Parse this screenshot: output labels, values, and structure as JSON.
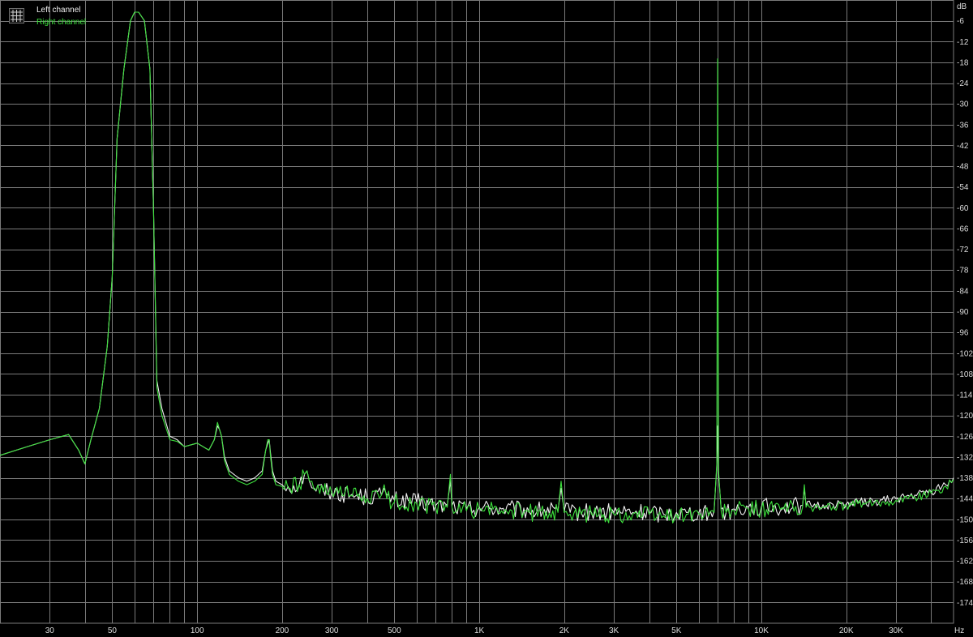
{
  "chart_data": {
    "type": "line",
    "title": "",
    "xlabel": "",
    "ylabel": "",
    "x_scale": "log",
    "x_unit": "Hz",
    "y_unit": "dB",
    "xlim": [
      20,
      48000
    ],
    "ylim": [
      -180,
      0
    ],
    "grid": true,
    "legend_position": "top-left",
    "legend_icon": "grid-icon",
    "x_ticks": [
      {
        "value": 30,
        "label": "30"
      },
      {
        "value": 50,
        "label": "50"
      },
      {
        "value": 100,
        "label": "100"
      },
      {
        "value": 200,
        "label": "200"
      },
      {
        "value": 300,
        "label": "300"
      },
      {
        "value": 500,
        "label": "500"
      },
      {
        "value": 1000,
        "label": "1K"
      },
      {
        "value": 2000,
        "label": "2K"
      },
      {
        "value": 3000,
        "label": "3K"
      },
      {
        "value": 5000,
        "label": "5K"
      },
      {
        "value": 10000,
        "label": "10K"
      },
      {
        "value": 20000,
        "label": "20K"
      },
      {
        "value": 30000,
        "label": "30K"
      }
    ],
    "x_minor_ticks": [
      40,
      60,
      70,
      80,
      90,
      400,
      600,
      700,
      800,
      900,
      4000,
      6000,
      7000,
      8000,
      9000,
      40000
    ],
    "y_ticks": [
      -6,
      -12,
      -18,
      -24,
      -30,
      -36,
      -42,
      -48,
      -54,
      -60,
      -66,
      -72,
      -78,
      -84,
      -90,
      -96,
      -102,
      -108,
      -114,
      -120,
      -126,
      -132,
      -138,
      -144,
      -150,
      -156,
      -162,
      -168,
      -174
    ],
    "colors": {
      "background": "#000000",
      "grid": "#7a7a7a",
      "ticks": "#dcdcdc",
      "legend_box": "#6e6e6e"
    },
    "series": [
      {
        "name": "Left channel",
        "color": "#f0f0f0",
        "x": [
          20,
          25,
          30,
          35,
          38,
          40,
          42,
          45,
          48,
          50,
          52,
          55,
          58,
          60,
          62,
          65,
          68,
          70,
          72,
          75,
          80,
          85,
          90,
          100,
          110,
          115,
          118,
          120,
          122,
          125,
          130,
          140,
          150,
          160,
          170,
          175,
          178,
          180,
          182,
          185,
          190,
          200,
          210,
          230,
          240,
          245,
          250,
          260,
          280,
          300,
          350,
          400,
          450,
          460,
          470,
          500,
          600,
          700,
          770,
          790,
          800,
          900,
          1000,
          1200,
          1500,
          1900,
          1950,
          2000,
          2100,
          2300,
          2500,
          3000,
          3500,
          4000,
          4500,
          5000,
          5500,
          6000,
          6500,
          6800,
          6950,
          7000,
          7050,
          7200,
          7500,
          8000,
          9000,
          10000,
          12000,
          14000,
          14200,
          14400,
          15000,
          17000,
          20000,
          22000,
          25000,
          30000,
          35000,
          40000,
          45000,
          48000
        ],
        "y": [
          -131.5,
          -129,
          -127,
          -125.5,
          -130,
          -134,
          -127,
          -118,
          -100,
          -80,
          -40,
          -20,
          -6,
          -3.5,
          -3.5,
          -6,
          -20,
          -60,
          -110,
          -118,
          -126,
          -127,
          -129,
          -128,
          -130,
          -127,
          -123,
          -124,
          -126,
          -132,
          -136,
          -138,
          -139,
          -138,
          -136,
          -130,
          -128,
          -127,
          -131,
          -136,
          -139,
          -140,
          -140.5,
          -140,
          -137,
          -136,
          -139,
          -141,
          -141.5,
          -142,
          -143,
          -143.5,
          -143,
          -141,
          -143,
          -144.5,
          -145,
          -146,
          -146,
          -139,
          -146,
          -147,
          -146.5,
          -147,
          -147.5,
          -147.5,
          -141,
          -147.5,
          -148,
          -148,
          -148,
          -148,
          -148,
          -148,
          -148.5,
          -148,
          -148,
          -148,
          -148.5,
          -147.5,
          -135,
          -123,
          -137,
          -147,
          -148,
          -147,
          -146.5,
          -146.5,
          -146.5,
          -146,
          -141,
          -146,
          -146,
          -146,
          -145.5,
          -145,
          -145,
          -144,
          -143,
          -142,
          -140,
          -138
        ]
      },
      {
        "name": "Right channel",
        "color": "#3de03d",
        "x": [
          20,
          25,
          30,
          35,
          38,
          40,
          42,
          45,
          48,
          50,
          52,
          55,
          58,
          60,
          62,
          65,
          68,
          70,
          72,
          75,
          80,
          85,
          90,
          100,
          110,
          115,
          118,
          120,
          122,
          125,
          130,
          140,
          150,
          160,
          170,
          175,
          178,
          180,
          182,
          185,
          190,
          200,
          210,
          230,
          240,
          245,
          250,
          260,
          280,
          300,
          350,
          400,
          450,
          460,
          470,
          500,
          600,
          700,
          770,
          790,
          800,
          900,
          1000,
          1200,
          1500,
          1900,
          1950,
          2000,
          2100,
          2300,
          2500,
          3000,
          3500,
          4000,
          4500,
          5000,
          5500,
          6000,
          6500,
          6800,
          6950,
          7000,
          7050,
          7200,
          7500,
          8000,
          9000,
          10000,
          12000,
          14000,
          14200,
          14400,
          15000,
          17000,
          20000,
          22000,
          25000,
          30000,
          35000,
          40000,
          45000,
          48000
        ],
        "y": [
          -131.5,
          -129,
          -127,
          -125.5,
          -130,
          -134,
          -127,
          -118,
          -100,
          -80,
          -40,
          -20,
          -6,
          -3.5,
          -3.5,
          -6,
          -20,
          -60,
          -112,
          -120,
          -127,
          -127.5,
          -129,
          -128,
          -130,
          -127,
          -122,
          -124,
          -126,
          -133,
          -137,
          -139,
          -140,
          -139,
          -137,
          -130,
          -127,
          -127,
          -132,
          -137,
          -140,
          -140.5,
          -141,
          -140,
          -137,
          -136,
          -139,
          -141.5,
          -142,
          -142.5,
          -143,
          -144,
          -143,
          -140,
          -144,
          -145,
          -145.5,
          -146.5,
          -146.5,
          -137,
          -146.5,
          -147.5,
          -147,
          -147.5,
          -148,
          -148,
          -139,
          -148,
          -148.5,
          -148.5,
          -148.5,
          -148.5,
          -148.5,
          -148.5,
          -149,
          -148.5,
          -148.5,
          -148.5,
          -149,
          -148,
          -134,
          -17,
          -136,
          -147.5,
          -148,
          -147.5,
          -147,
          -147,
          -147,
          -146.5,
          -140,
          -146.5,
          -146.5,
          -146.5,
          -146,
          -145.5,
          -145.5,
          -144.5,
          -143.5,
          -142.5,
          -140.5,
          -138.5
        ]
      }
    ]
  }
}
